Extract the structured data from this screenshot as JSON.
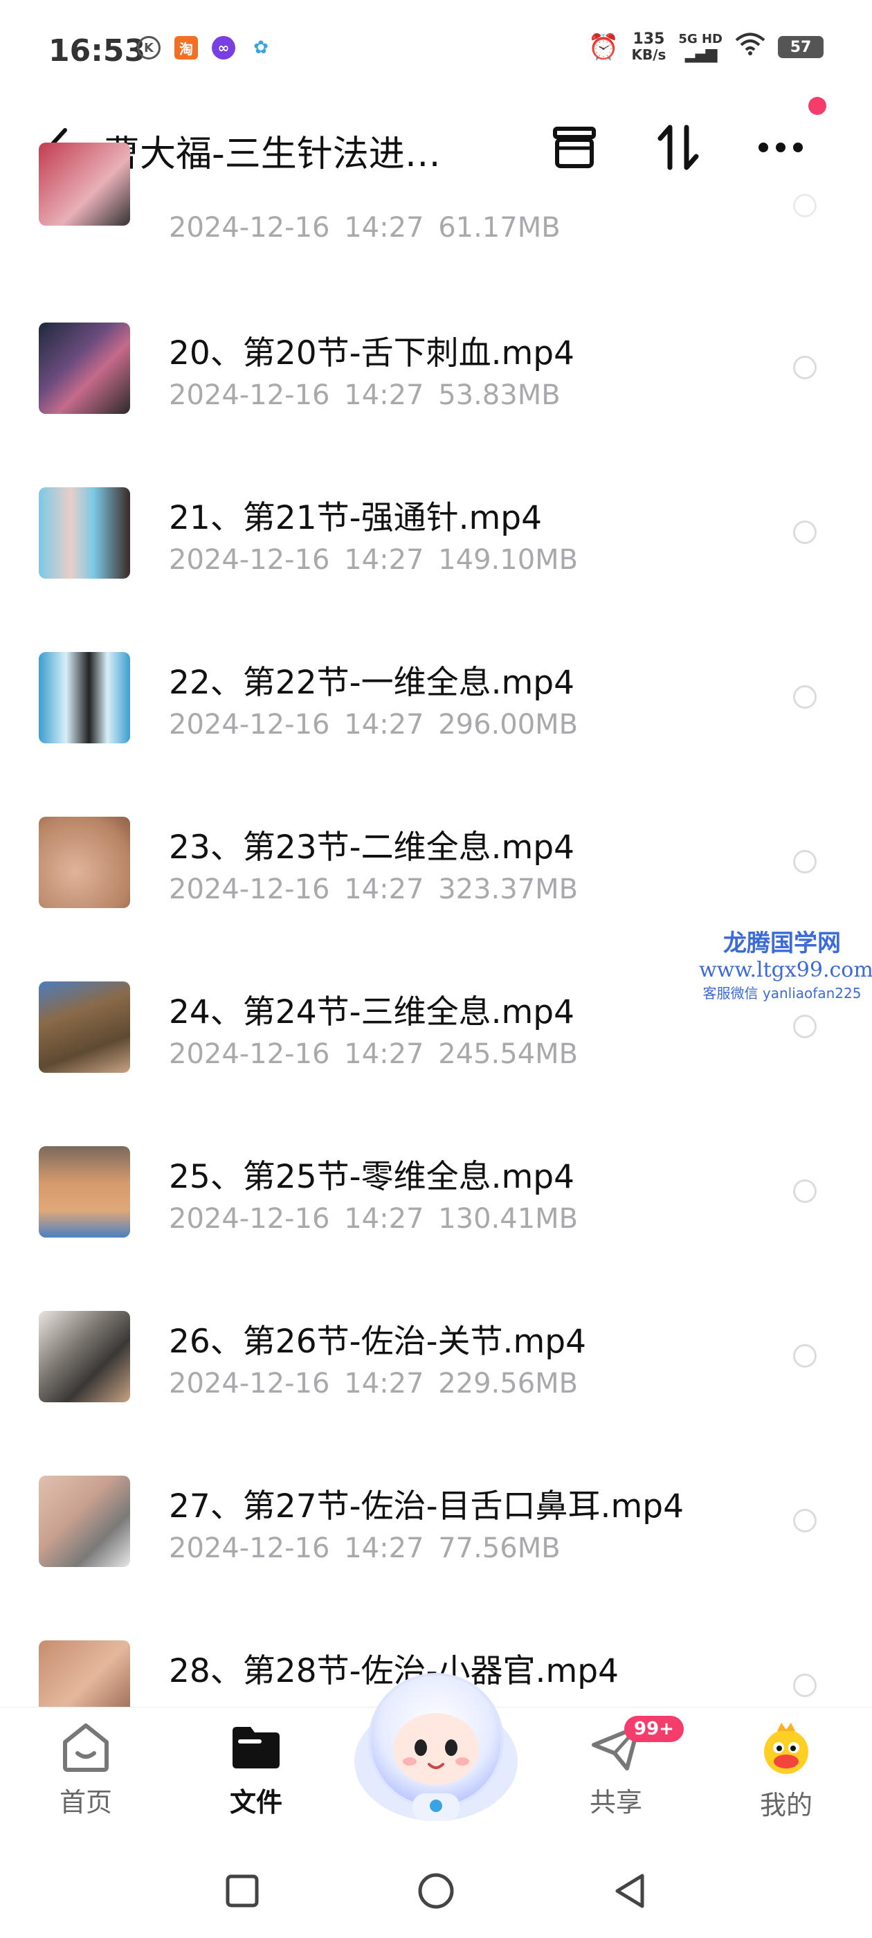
{
  "status_bar": {
    "time": "16:53",
    "net_speed_value": "135",
    "net_speed_unit": "KB/s",
    "network": "5G HD",
    "battery": "57"
  },
  "header": {
    "title": "曹大福-三生针法进…"
  },
  "files": [
    {
      "name": "",
      "date": "2024-12-16",
      "time": "14:27",
      "size": "61.17MB",
      "thumb_color": "#b23a4a"
    },
    {
      "name": "20、第20节-舌下刺血.mp4",
      "date": "2024-12-16",
      "time": "14:27",
      "size": "53.83MB",
      "thumb_color": "#7a4b6e"
    },
    {
      "name": "21、第21节-强通针.mp4",
      "date": "2024-12-16",
      "time": "14:27",
      "size": "149.10MB",
      "thumb_color": "#5aa9c8"
    },
    {
      "name": "22、第22节-一维全息.mp4",
      "date": "2024-12-16",
      "time": "14:27",
      "size": "296.00MB",
      "thumb_color": "#4a8fb8"
    },
    {
      "name": "23、第23节-二维全息.mp4",
      "date": "2024-12-16",
      "time": "14:27",
      "size": "323.37MB",
      "thumb_color": "#c79a7c"
    },
    {
      "name": "24、第24节-三维全息.mp4",
      "date": "2024-12-16",
      "time": "14:27",
      "size": "245.54MB",
      "thumb_color": "#8c7256"
    },
    {
      "name": "25、第25节-零维全息.mp4",
      "date": "2024-12-16",
      "time": "14:27",
      "size": "130.41MB",
      "thumb_color": "#c88a64"
    },
    {
      "name": "26、第26节-佐治-关节.mp4",
      "date": "2024-12-16",
      "time": "14:27",
      "size": "229.56MB",
      "thumb_color": "#6f6a66"
    },
    {
      "name": "27、第27节-佐治-目舌口鼻耳.mp4",
      "date": "2024-12-16",
      "time": "14:27",
      "size": "77.56MB",
      "thumb_color": "#caa190"
    },
    {
      "name": "28、第28节-佐治-小器官.mp4",
      "date": "",
      "time": "",
      "size": "",
      "thumb_color": "#b8836a"
    }
  ],
  "watermark": {
    "line1": "龙腾国学网",
    "line2": "www.ltgx99.com",
    "line3": "客服微信 yanliaofan225"
  },
  "bottom_nav": {
    "home": "首页",
    "files": "文件",
    "share": "共享",
    "share_badge": "99+",
    "mine": "我的"
  },
  "colors": {
    "accent": "#f43d6b",
    "meta_text": "#a9a9ad"
  }
}
